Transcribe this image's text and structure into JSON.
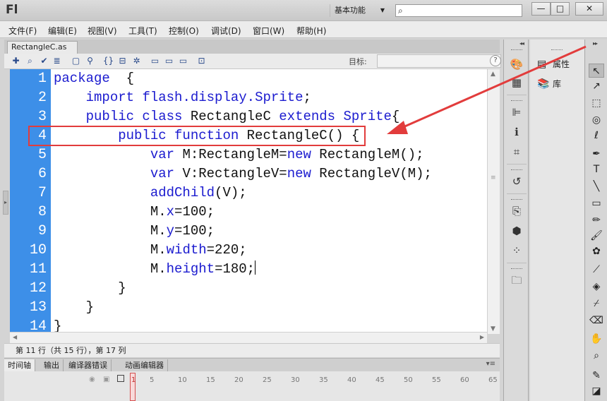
{
  "app": {
    "logo": "Fl",
    "workspace": "基本功能",
    "window_buttons": [
      "—",
      "□",
      "✕"
    ]
  },
  "menu": [
    "文件(F)",
    "编辑(E)",
    "视图(V)",
    "工具(T)",
    "控制(O)",
    "调试(D)",
    "窗口(W)",
    "帮助(H)"
  ],
  "document_tab": "RectangleC.as",
  "toolbar": {
    "target_label": "目标:"
  },
  "code": {
    "line_numbers": [
      "1",
      "2",
      "3",
      "4",
      "5",
      "6",
      "7",
      "8",
      "9",
      "10",
      "11",
      "12",
      "13",
      "14"
    ],
    "lines": [
      [
        {
          "t": "package",
          "k": 1
        },
        {
          "t": "  {",
          "k": 0
        }
      ],
      [
        {
          "t": "    ",
          "k": 0
        },
        {
          "t": "import",
          "k": 1
        },
        {
          "t": " ",
          "k": 0
        },
        {
          "t": "flash.display.Sprite",
          "k": 1
        },
        {
          "t": ";",
          "k": 0
        }
      ],
      [
        {
          "t": "    ",
          "k": 0
        },
        {
          "t": "public class",
          "k": 1
        },
        {
          "t": " RectangleC ",
          "k": 0
        },
        {
          "t": "extends",
          "k": 1
        },
        {
          "t": " ",
          "k": 0
        },
        {
          "t": "Sprite",
          "k": 1
        },
        {
          "t": "{",
          "k": 0
        }
      ],
      [
        {
          "t": "        ",
          "k": 0
        },
        {
          "t": "public function",
          "k": 1
        },
        {
          "t": " RectangleC() {",
          "k": 0
        }
      ],
      [
        {
          "t": "            ",
          "k": 0
        },
        {
          "t": "var",
          "k": 1
        },
        {
          "t": " M:RectangleM=",
          "k": 0
        },
        {
          "t": "new",
          "k": 1
        },
        {
          "t": " RectangleM();",
          "k": 0
        }
      ],
      [
        {
          "t": "            ",
          "k": 0
        },
        {
          "t": "var",
          "k": 1
        },
        {
          "t": " V:RectangleV=",
          "k": 0
        },
        {
          "t": "new",
          "k": 1
        },
        {
          "t": " RectangleV(M);",
          "k": 0
        }
      ],
      [
        {
          "t": "            ",
          "k": 0
        },
        {
          "t": "addChild",
          "k": 1
        },
        {
          "t": "(V);",
          "k": 0
        }
      ],
      [
        {
          "t": "            M.",
          "k": 0
        },
        {
          "t": "x",
          "k": 1
        },
        {
          "t": "=100;",
          "k": 0
        }
      ],
      [
        {
          "t": "            M.",
          "k": 0
        },
        {
          "t": "y",
          "k": 1
        },
        {
          "t": "=100;",
          "k": 0
        }
      ],
      [
        {
          "t": "            M.",
          "k": 0
        },
        {
          "t": "width",
          "k": 1
        },
        {
          "t": "=220;",
          "k": 0
        }
      ],
      [
        {
          "t": "            M.",
          "k": 0
        },
        {
          "t": "height",
          "k": 1
        },
        {
          "t": "=180;",
          "k": 0
        }
      ],
      [
        {
          "t": "        }",
          "k": 0
        }
      ],
      [
        {
          "t": "    }",
          "k": 0
        }
      ],
      [
        {
          "t": "}",
          "k": 0
        }
      ]
    ]
  },
  "status": "第 11 行（共 15 行），第 17 列",
  "bottom_tabs": [
    "时间轴",
    "输出",
    "编译器错误",
    "动画编辑器"
  ],
  "timeline_ticks": [
    "1",
    "5",
    "10",
    "15",
    "20",
    "25",
    "30",
    "35",
    "40",
    "45",
    "50",
    "55",
    "60",
    "65"
  ],
  "properties_panel": {
    "properties": "属性",
    "library": "库"
  },
  "colors": {
    "gutter": "#3d8fe8",
    "keyword": "#1b1bcf",
    "annotation": "#e23c3c"
  }
}
